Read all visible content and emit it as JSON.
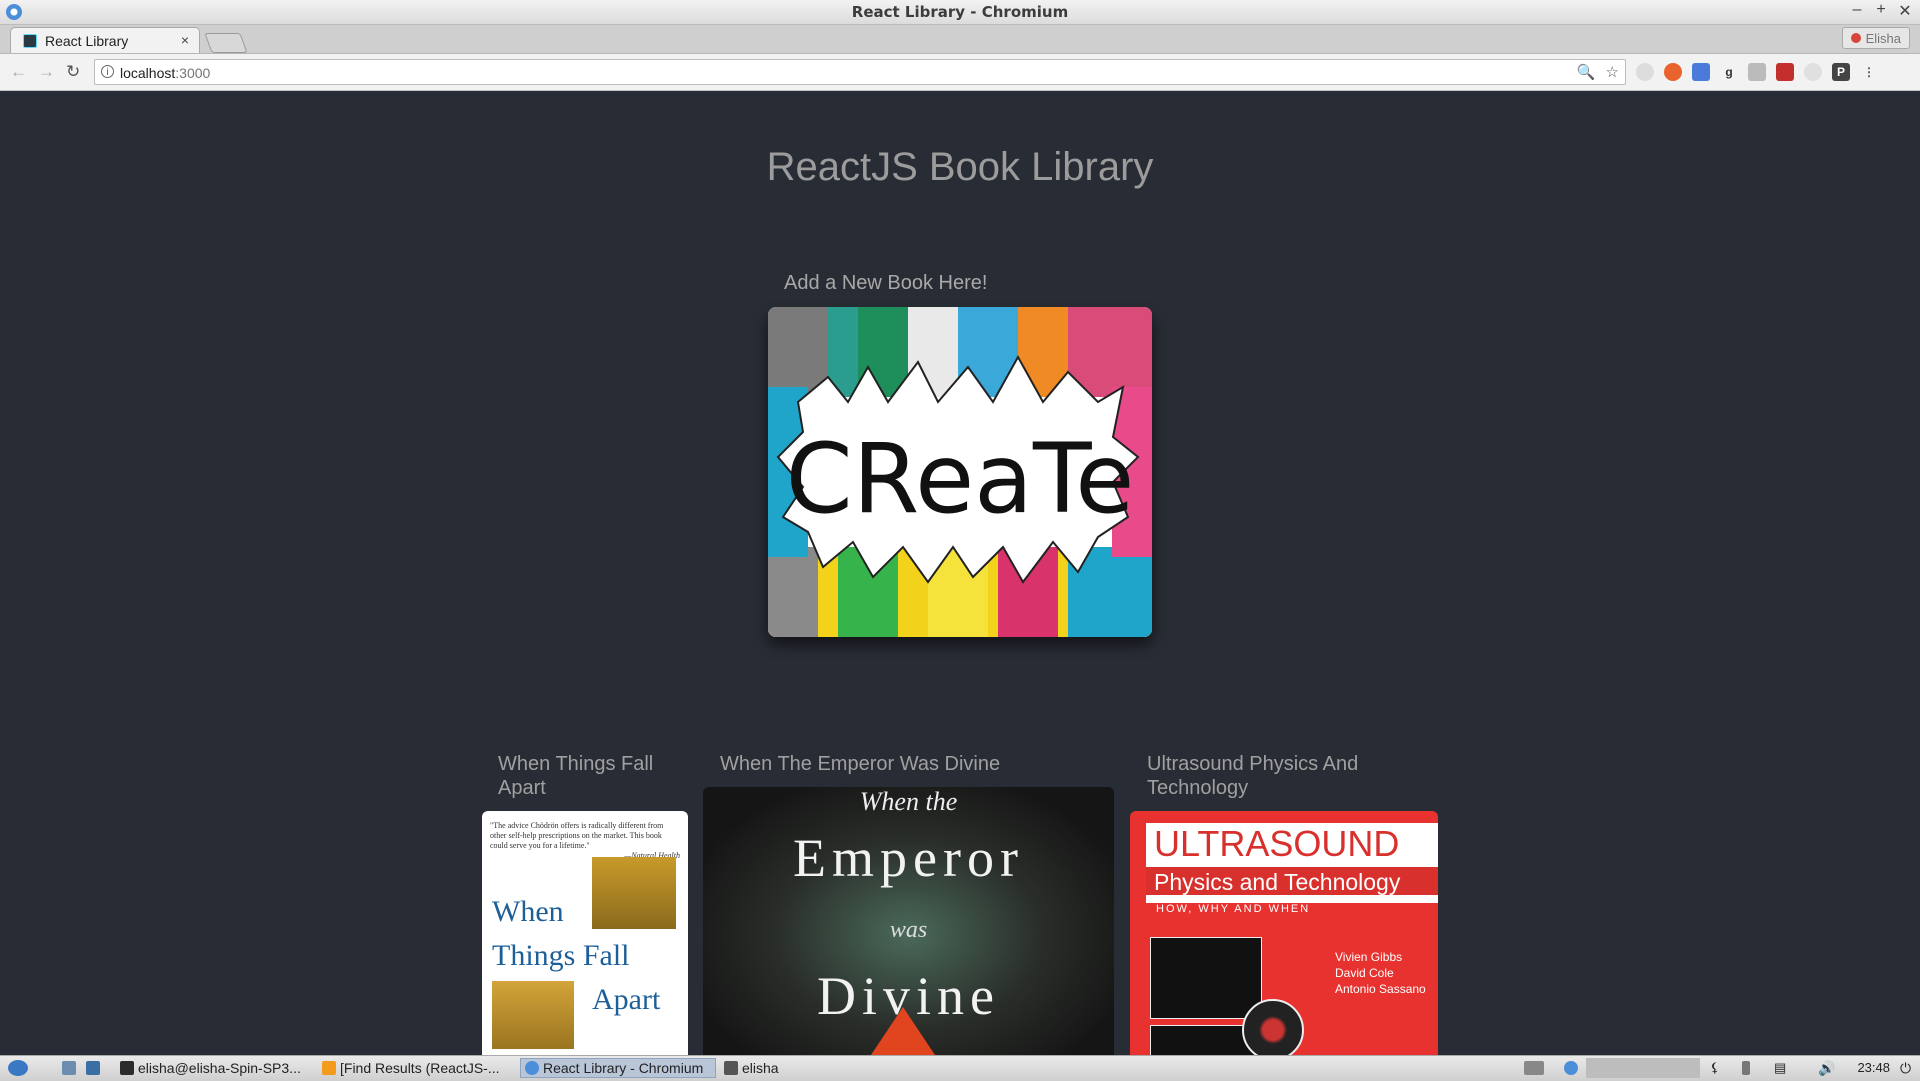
{
  "window": {
    "title": "React Library - Chromium",
    "controls": [
      "–",
      "+",
      "✕"
    ]
  },
  "tab": {
    "label": "React Library",
    "close": "×"
  },
  "profile": {
    "name": "Elisha"
  },
  "address": {
    "host": "localhost",
    "port": ":3000"
  },
  "page": {
    "title": "ReactJS Book Library",
    "add_label": "Add a New Book Here!",
    "create_word": "CReaTe"
  },
  "books": [
    {
      "title": "When Things Fall Apart",
      "cover_quote": "\"The advice Chödrön offers is radically different from other self-help prescriptions on the market. This book could serve you for a lifetime.\"",
      "cover_quote_src": "—Natural Health",
      "cover_words": [
        "When",
        "Things Fall",
        "Apart"
      ]
    },
    {
      "title": "When The Emperor Was Divine",
      "cover_words": [
        "When the",
        "Emperor",
        "was",
        "Divine"
      ]
    },
    {
      "title": "Ultrasound Physics And Technology",
      "cover_heading": "ULTRASOUND",
      "cover_sub": "Physics and Technology",
      "cover_tagline": "HOW, WHY AND WHEN",
      "cover_authors": [
        "Vivien Gibbs",
        "David Cole",
        "Antonio Sassano"
      ]
    }
  ],
  "taskbar": {
    "items": [
      "elisha@elisha-Spin-SP3...",
      "[Find Results (ReactJS-...",
      "React Library - Chromium",
      "elisha"
    ],
    "clock": "23:48"
  },
  "colors": {
    "page_bg": "#282c34",
    "ultrasound_red": "#e8322f"
  }
}
